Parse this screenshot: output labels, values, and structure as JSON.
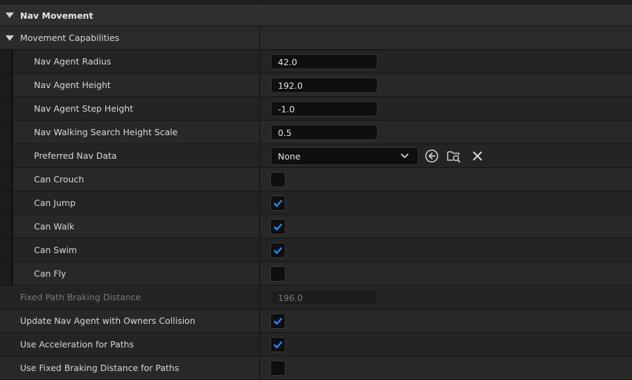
{
  "panel": {
    "section_title": "Nav Movement",
    "group_title": "Movement Capabilities"
  },
  "fields": {
    "nav_agent_radius": {
      "label": "Nav Agent Radius",
      "value": "42.0"
    },
    "nav_agent_height": {
      "label": "Nav Agent Height",
      "value": "192.0"
    },
    "nav_agent_step_height": {
      "label": "Nav Agent Step Height",
      "value": "-1.0"
    },
    "nav_walking_search_height_scale": {
      "label": "Nav Walking Search Height Scale",
      "value": "0.5"
    },
    "preferred_nav_data": {
      "label": "Preferred Nav Data",
      "value": "None"
    },
    "can_crouch": {
      "label": "Can Crouch",
      "checked": false
    },
    "can_jump": {
      "label": "Can Jump",
      "checked": true
    },
    "can_walk": {
      "label": "Can Walk",
      "checked": true
    },
    "can_swim": {
      "label": "Can Swim",
      "checked": true
    },
    "can_fly": {
      "label": "Can Fly",
      "checked": false
    },
    "fixed_path_braking_distance": {
      "label": "Fixed Path Braking Distance",
      "value": "196.0",
      "disabled": true
    },
    "update_nav_agent_with_owners_collision": {
      "label": "Update Nav Agent with Owners Collision",
      "checked": true
    },
    "use_acceleration_for_paths": {
      "label": "Use Acceleration for Paths",
      "checked": true
    },
    "use_fixed_braking_distance_for_paths": {
      "label": "Use Fixed Braking Distance for Paths",
      "checked": false
    }
  },
  "icons": {
    "use_selected": "arrow-left-circle-icon",
    "browse": "folder-search-icon",
    "clear": "close-icon",
    "dropdown": "chevron-down-icon",
    "check": "checkmark-icon"
  },
  "colors": {
    "check_accent": "#1e90ff",
    "background": "#242424",
    "field_bg": "#0f0f0f"
  }
}
